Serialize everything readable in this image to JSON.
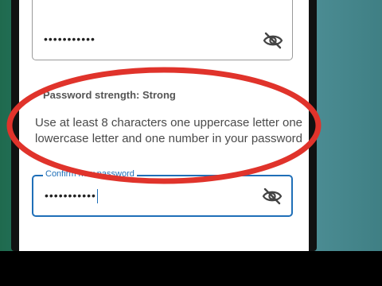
{
  "password_field": {
    "masked_value": "•••••••••••",
    "toggle_icon": "eye-off-icon"
  },
  "strength": {
    "label": "Password strength: Strong"
  },
  "requirements": {
    "hint": "Use at least 8 characters one uppercase letter one lowercase letter and one number in your password"
  },
  "confirm_field": {
    "label": "Confirm new password",
    "masked_value": "•••••••••••",
    "toggle_icon": "eye-off-icon"
  },
  "colors": {
    "accent": "#1f6fb8",
    "annotation_ring": "#e0332b"
  }
}
